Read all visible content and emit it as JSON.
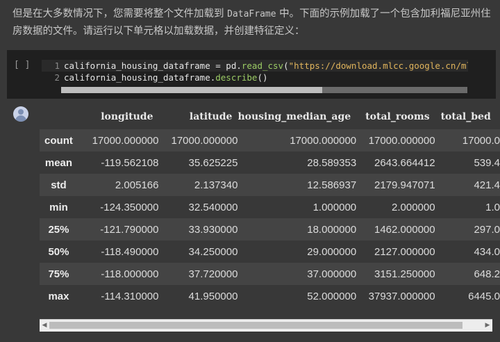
{
  "intro": {
    "part1": "但是在大多数情况下，您需要将整个文件加载到",
    "code_term": "DataFrame",
    "part2": "中。下面的示例加载了一个包含加利福尼亚州住房数据的文件。请运行以下单元格以加载数据，并创建特征定义："
  },
  "code_cell": {
    "run_label": "[ ]",
    "lines": [
      {
        "num": "1",
        "var": "california_housing_dataframe",
        "op": " = pd.",
        "fn": "read_csv",
        "open": "(",
        "str": "\"https://download.mlcc.google.cn/mledu"
      },
      {
        "num": "2",
        "var": "california_housing_dataframe.",
        "fn": "describe",
        "close": "()"
      }
    ]
  },
  "dataframe": {
    "columns": [
      "longitude",
      "latitude",
      "housing_median_age",
      "total_rooms",
      "total_bed"
    ],
    "rows": [
      {
        "label": "count",
        "values": [
          "17000.000000",
          "17000.000000",
          "17000.000000",
          "17000.000000",
          "17000.0"
        ]
      },
      {
        "label": "mean",
        "values": [
          "-119.562108",
          "35.625225",
          "28.589353",
          "2643.664412",
          "539.4"
        ]
      },
      {
        "label": "std",
        "values": [
          "2.005166",
          "2.137340",
          "12.586937",
          "2179.947071",
          "421.4"
        ]
      },
      {
        "label": "min",
        "values": [
          "-124.350000",
          "32.540000",
          "1.000000",
          "2.000000",
          "1.0"
        ]
      },
      {
        "label": "25%",
        "values": [
          "-121.790000",
          "33.930000",
          "18.000000",
          "1462.000000",
          "297.0"
        ]
      },
      {
        "label": "50%",
        "values": [
          "-118.490000",
          "34.250000",
          "29.000000",
          "2127.000000",
          "434.0"
        ]
      },
      {
        "label": "75%",
        "values": [
          "-118.000000",
          "37.720000",
          "37.000000",
          "3151.250000",
          "648.2"
        ]
      },
      {
        "label": "max",
        "values": [
          "-114.310000",
          "41.950000",
          "52.000000",
          "37937.000000",
          "6445.0"
        ]
      }
    ]
  },
  "icons": {
    "avatar": "user-avatar-icon",
    "scroll_left": "◀",
    "scroll_right": "▶"
  }
}
